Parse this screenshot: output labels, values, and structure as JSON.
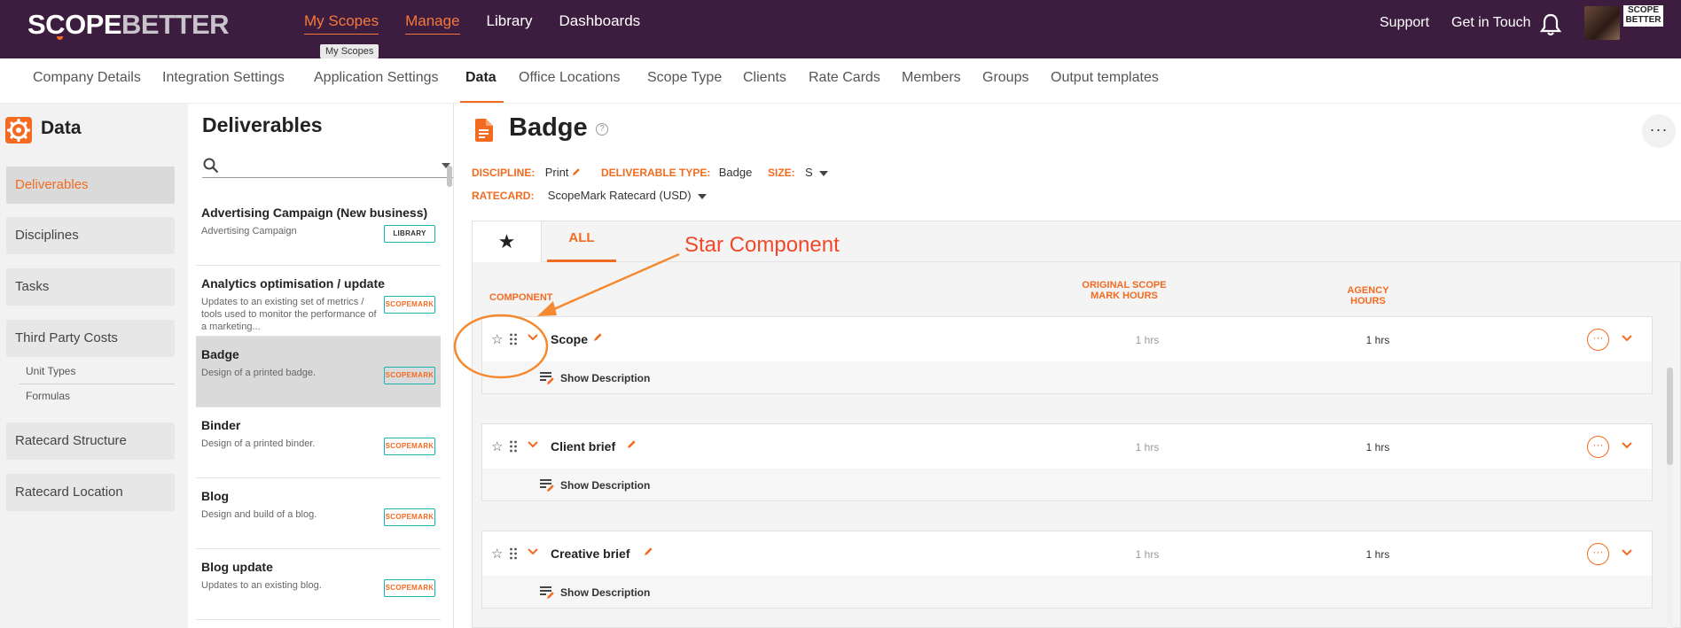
{
  "topnav": {
    "logo_scope": "SCOPE",
    "logo_better": "BETTER",
    "items": [
      {
        "label": "My Scopes"
      },
      {
        "label": "Manage"
      },
      {
        "label": "Library"
      },
      {
        "label": "Dashboards"
      }
    ],
    "tooltip": "My Scopes",
    "support": "Support",
    "get_in_touch": "Get in Touch",
    "brand_mini": "SCOPE BETTER"
  },
  "subnav": {
    "tabs": [
      {
        "label": "Company Details"
      },
      {
        "label": "Integration Settings"
      },
      {
        "label": "Application Settings"
      },
      {
        "label": "Data"
      },
      {
        "label": "Office Locations"
      },
      {
        "label": "Scope Type"
      },
      {
        "label": "Clients"
      },
      {
        "label": "Rate Cards"
      },
      {
        "label": "Members"
      },
      {
        "label": "Groups"
      },
      {
        "label": "Output templates"
      }
    ]
  },
  "sidebar": {
    "title": "Data",
    "items": [
      {
        "label": "Deliverables"
      },
      {
        "label": "Disciplines"
      },
      {
        "label": "Tasks"
      },
      {
        "label": "Third Party Costs"
      },
      {
        "label": "Unit Types"
      },
      {
        "label": "Formulas"
      },
      {
        "label": "Ratecard Structure"
      },
      {
        "label": "Ratecard Location"
      }
    ]
  },
  "deliverables": {
    "title": "Deliverables",
    "search_value": "",
    "items": [
      {
        "name": "Advertising Campaign (New business)",
        "desc": "Advertising Campaign",
        "badge": "LIBRARY"
      },
      {
        "name": "Analytics optimisation / update",
        "desc": "Updates to an existing set of metrics / tools used to monitor the performance of a marketing...",
        "badge": "SCOPEMARK"
      },
      {
        "name": "Badge",
        "desc": "Design of a printed badge.",
        "badge": "SCOPEMARK"
      },
      {
        "name": "Binder",
        "desc": "Design of a printed binder.",
        "badge": "SCOPEMARK"
      },
      {
        "name": "Blog",
        "desc": "Design and build of a blog.",
        "badge": "SCOPEMARK"
      },
      {
        "name": "Blog update",
        "desc": "Updates to an existing blog.",
        "badge": "SCOPEMARK"
      }
    ]
  },
  "main": {
    "title": "Badge",
    "more": "···",
    "discipline_label": "DISCIPLINE:",
    "discipline_value": "Print",
    "deliverable_type_label": "DELIVERABLE TYPE:",
    "deliverable_type_value": "Badge",
    "size_label": "SIZE:",
    "size_value": "S",
    "ratecard_label": "RATECARD:",
    "ratecard_value": "ScopeMark Ratecard (USD)",
    "tab_all": "ALL",
    "col_component": "COMPONENT",
    "col_original": "ORIGINAL SCOPE MARK HOURS",
    "col_agency": "AGENCY HOURS",
    "components": [
      {
        "name": "Scope",
        "original": "1 hrs",
        "agency": "1 hrs",
        "show_desc": "Show Description"
      },
      {
        "name": "Client brief",
        "original": "1 hrs",
        "agency": "1 hrs",
        "show_desc": "Show Description"
      },
      {
        "name": "Creative brief",
        "original": "1 hrs",
        "agency": "1 hrs",
        "show_desc": "Show Description"
      }
    ]
  },
  "annotation": {
    "text": "Star Component"
  },
  "colors": {
    "accent": "#f26b21",
    "nav_bg": "#3d1d3f",
    "badge_border": "#19b3b3",
    "annotation": "#f0492a"
  }
}
